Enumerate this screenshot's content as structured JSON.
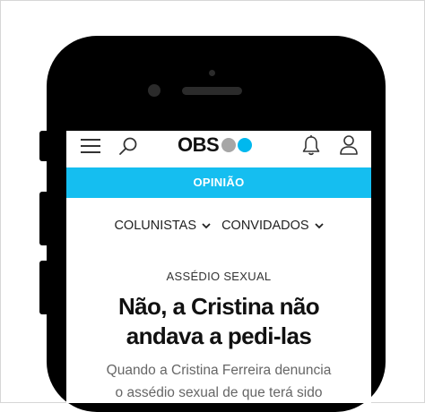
{
  "header": {
    "logo_text": "OBS",
    "icons": [
      "menu-icon",
      "search-icon",
      "bell-icon",
      "user-icon"
    ]
  },
  "section": {
    "label": "OPINIÃO"
  },
  "subnav": {
    "items": [
      {
        "label": "COLUNISTAS"
      },
      {
        "label": "CONVIDADOS"
      }
    ]
  },
  "article": {
    "kicker": "ASSÉDIO SEXUAL",
    "headline_line1": "Não, a Cristina não",
    "headline_line2": "andava a pedi-las",
    "lede_line1": "Quando a Cristina Ferreira denuncia",
    "lede_line2": "o assédio sexual de que terá sido"
  },
  "colors": {
    "accent": "#15bef0",
    "logo_blue": "#00b8ee",
    "logo_grey": "#a6a6a6"
  }
}
